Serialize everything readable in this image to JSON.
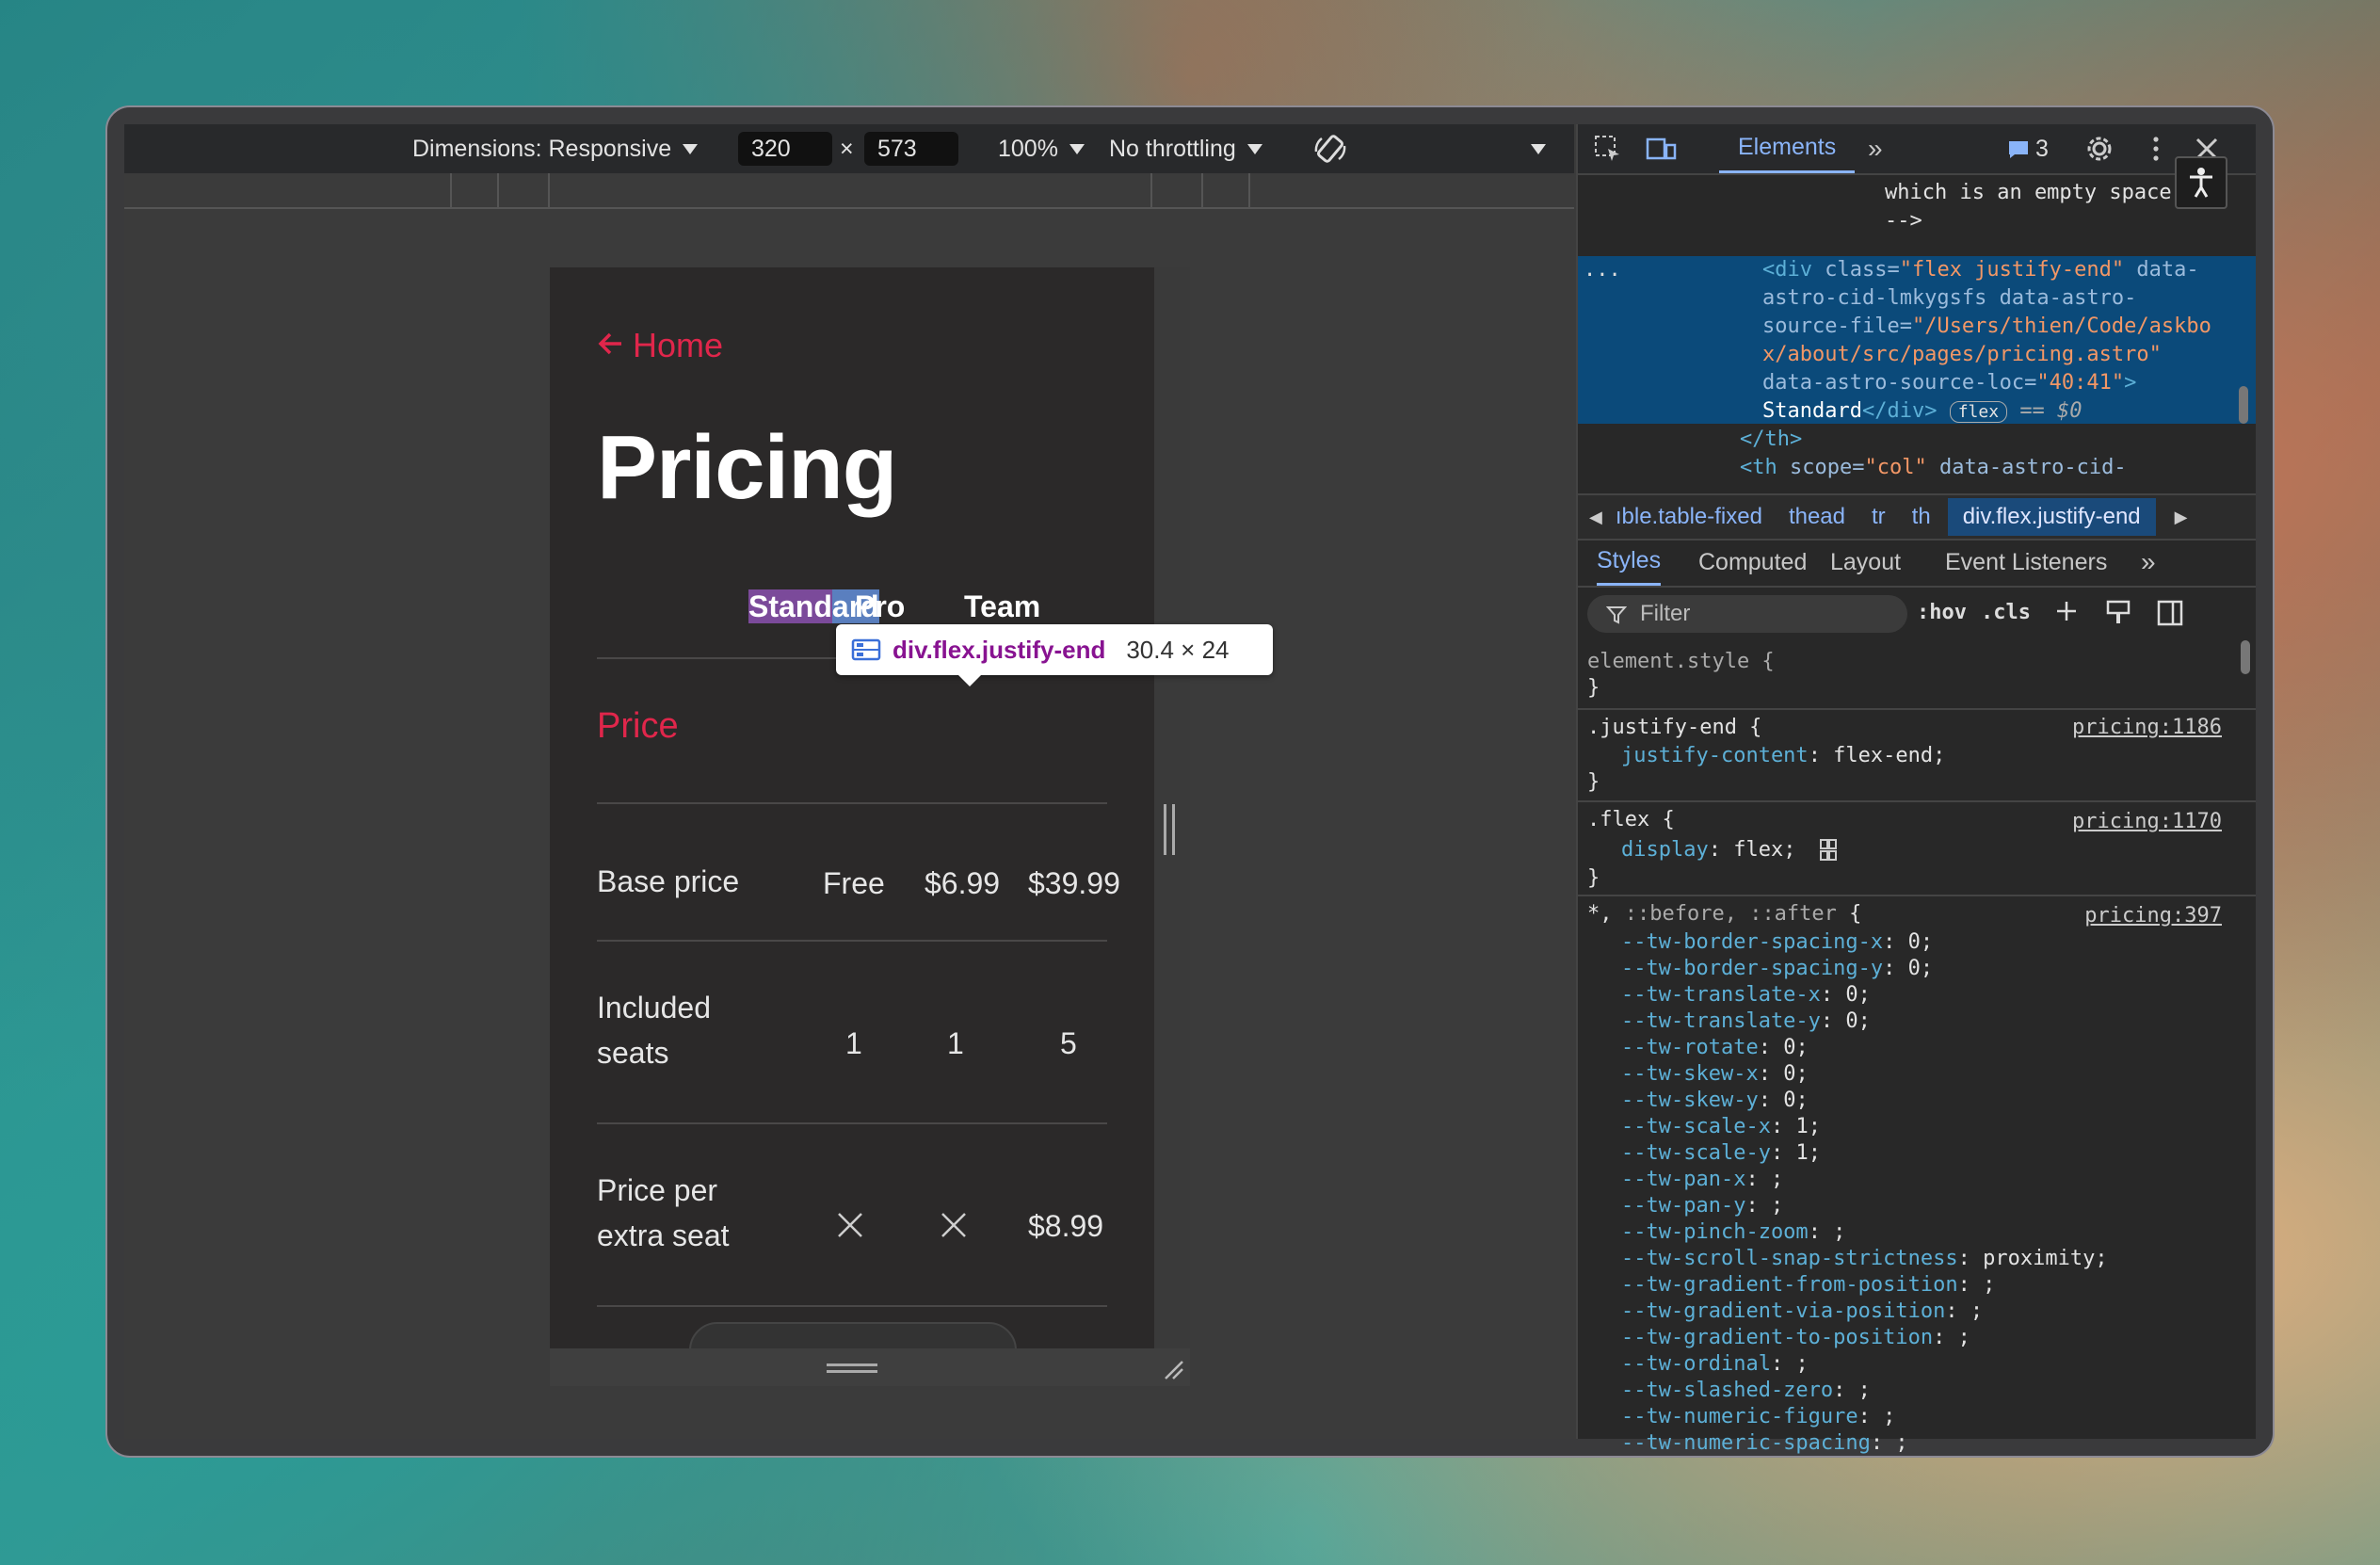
{
  "device_toolbar": {
    "dimensions_label": "Dimensions: Responsive",
    "width": "320",
    "times": "×",
    "height": "573",
    "zoom": "100%",
    "throttling": "No throttling"
  },
  "page": {
    "home_link": "Home",
    "title": "Pricing",
    "columns": [
      "Standard",
      "Pro",
      "Team"
    ],
    "section": "Price",
    "rows": [
      {
        "label": "Base price",
        "values": [
          "Free",
          "$6.99",
          "$39.99"
        ]
      },
      {
        "label_lines": [
          "Included",
          "seats"
        ],
        "values": [
          "1",
          "1",
          "5"
        ]
      },
      {
        "label_lines": [
          "Price per",
          "extra seat"
        ],
        "values": [
          "x-icon",
          "x-icon",
          "$8.99"
        ]
      }
    ]
  },
  "tooltip": {
    "selector": "div.flex.justify-end",
    "dimensions": "30.4 × 24"
  },
  "devtools": {
    "tab_active": "Elements",
    "issues_count": "3",
    "code_lines": {
      "l1": "which is an empty space.",
      "l2": "-->",
      "l3a": "<div ",
      "l3b": "class=",
      "l3c": "\"flex justify-end\"",
      "l3d": " data-",
      "l4": "astro-cid-lmkygsfs data-astro-",
      "l5a": "source-file=",
      "l5b": "\"/Users/thien/Code/askbo",
      "l6": "x/about/src/pages/pricing.astro\"",
      "l7a": "data-astro-source-loc=",
      "l7b": "\"40:41\"",
      "l7c": ">",
      "l8a": "Standard",
      "l8b": "</div>",
      "l8c": "flex",
      "l8d": "== $0",
      "l9": "</th>",
      "l10a": "<th ",
      "l10b": "scope=",
      "l10c": "\"col\"",
      "l10d": " data-astro-cid-",
      "ellipsis": "..."
    },
    "breadcrumbs": [
      "ıble.table-fixed",
      "thead",
      "tr",
      "th",
      "div.flex.justify-end"
    ],
    "sub_tabs": [
      "Styles",
      "Computed",
      "Layout",
      "Event Listeners"
    ],
    "filter_placeholder": "Filter",
    "hov": ":hov",
    "cls": ".cls",
    "styles": {
      "element_style": "element.style {",
      "close": "}",
      "justify_sel": ".justify-end {",
      "justify_src": "pricing:1186",
      "justify_prop": "justify-content",
      "justify_val": ": flex-end;",
      "flex_sel": ".flex {",
      "flex_src": "pricing:1170",
      "flex_prop": "display",
      "flex_val": ": flex;",
      "universal_sel_a": "*,",
      "universal_sel_b": " ::before, ::after",
      "universal_sel_c": " {",
      "universal_src": "pricing:397",
      "vars": [
        {
          "p": "--tw-border-spacing-x",
          "v": ": 0;"
        },
        {
          "p": "--tw-border-spacing-y",
          "v": ": 0;"
        },
        {
          "p": "--tw-translate-x",
          "v": ": 0;"
        },
        {
          "p": "--tw-translate-y",
          "v": ": 0;"
        },
        {
          "p": "--tw-rotate",
          "v": ": 0;"
        },
        {
          "p": "--tw-skew-x",
          "v": ": 0;"
        },
        {
          "p": "--tw-skew-y",
          "v": ": 0;"
        },
        {
          "p": "--tw-scale-x",
          "v": ": 1;"
        },
        {
          "p": "--tw-scale-y",
          "v": ": 1;"
        },
        {
          "p": "--tw-pan-x",
          "v": ": ;"
        },
        {
          "p": "--tw-pan-y",
          "v": ": ;"
        },
        {
          "p": "--tw-pinch-zoom",
          "v": ": ;"
        },
        {
          "p": "--tw-scroll-snap-strictness",
          "v": ": proximity;"
        },
        {
          "p": "--tw-gradient-from-position",
          "v": ": ;"
        },
        {
          "p": "--tw-gradient-via-position",
          "v": ": ;"
        },
        {
          "p": "--tw-gradient-to-position",
          "v": ": ;"
        },
        {
          "p": "--tw-ordinal",
          "v": ": ;"
        },
        {
          "p": "--tw-slashed-zero",
          "v": ": ;"
        },
        {
          "p": "--tw-numeric-figure",
          "v": ": ;"
        },
        {
          "p": "--tw-numeric-spacing",
          "v": ": ;"
        }
      ]
    }
  },
  "colors": {
    "accent_red": "#e0264b",
    "devtools_blue": "#8ab4f8",
    "selection_bg": "#0b4a7a"
  }
}
